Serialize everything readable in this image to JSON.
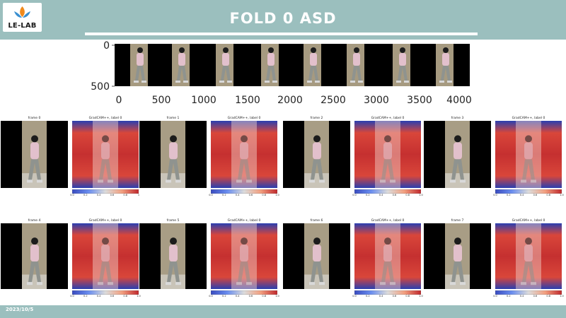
{
  "header": {
    "logo_text": "LE-LAB",
    "title": "FOLD 0 ASD",
    "accent_color": "#9bbfbe"
  },
  "strip": {
    "x_ticks": [
      "0",
      "500",
      "1000",
      "1500",
      "2000",
      "2500",
      "3000",
      "3500",
      "4000"
    ],
    "y_ticks": [
      "0",
      "500"
    ]
  },
  "frames": [
    {
      "label": "frame 0"
    },
    {
      "label": "frame 1"
    },
    {
      "label": "frame 2"
    },
    {
      "label": "frame 3"
    },
    {
      "label": "frame 4"
    },
    {
      "label": "frame 5"
    },
    {
      "label": "frame 6"
    },
    {
      "label": "frame 7"
    }
  ],
  "gradcam": [
    {
      "label": "GradCAM++, label 0",
      "ticks": [
        "0.0",
        "0.2",
        "0.4",
        "0.6",
        "0.8",
        "1"
      ]
    },
    {
      "label": "GradCAM++, label 0",
      "ticks": [
        "0.0",
        "0.2",
        "0.4",
        "0.6",
        "0.8",
        "1.0"
      ]
    },
    {
      "label": "GradCAM++, label 0",
      "ticks": [
        "0.0",
        "0.2",
        "0.4",
        "0.6",
        "0.8",
        "1.0"
      ]
    },
    {
      "label": "GradCAM++, label 0",
      "ticks": [
        "0.0",
        "0.2",
        "0.4",
        "0.6",
        "0.8",
        "1.0"
      ]
    },
    {
      "label": "GradCAM++, label 0",
      "ticks": [
        "0.0",
        "0.2",
        "0.4",
        "0.6",
        "0.8",
        "1.0"
      ]
    },
    {
      "label": "GradCAM++, label 0",
      "ticks": [
        "0.0",
        "0.2",
        "0.4",
        "0.6",
        "0.8",
        "1.0"
      ]
    },
    {
      "label": "GradCAM++, label 0",
      "ticks": [
        "0.0",
        "0.2",
        "0.4",
        "0.6",
        "0.8",
        "1.0"
      ]
    },
    {
      "label": "GradCAM++, label 0",
      "ticks": [
        "0.0",
        "0.2",
        "0.4",
        "0.6",
        "0.8",
        "1.0"
      ]
    }
  ],
  "footer": {
    "date": "2023/10/5"
  }
}
